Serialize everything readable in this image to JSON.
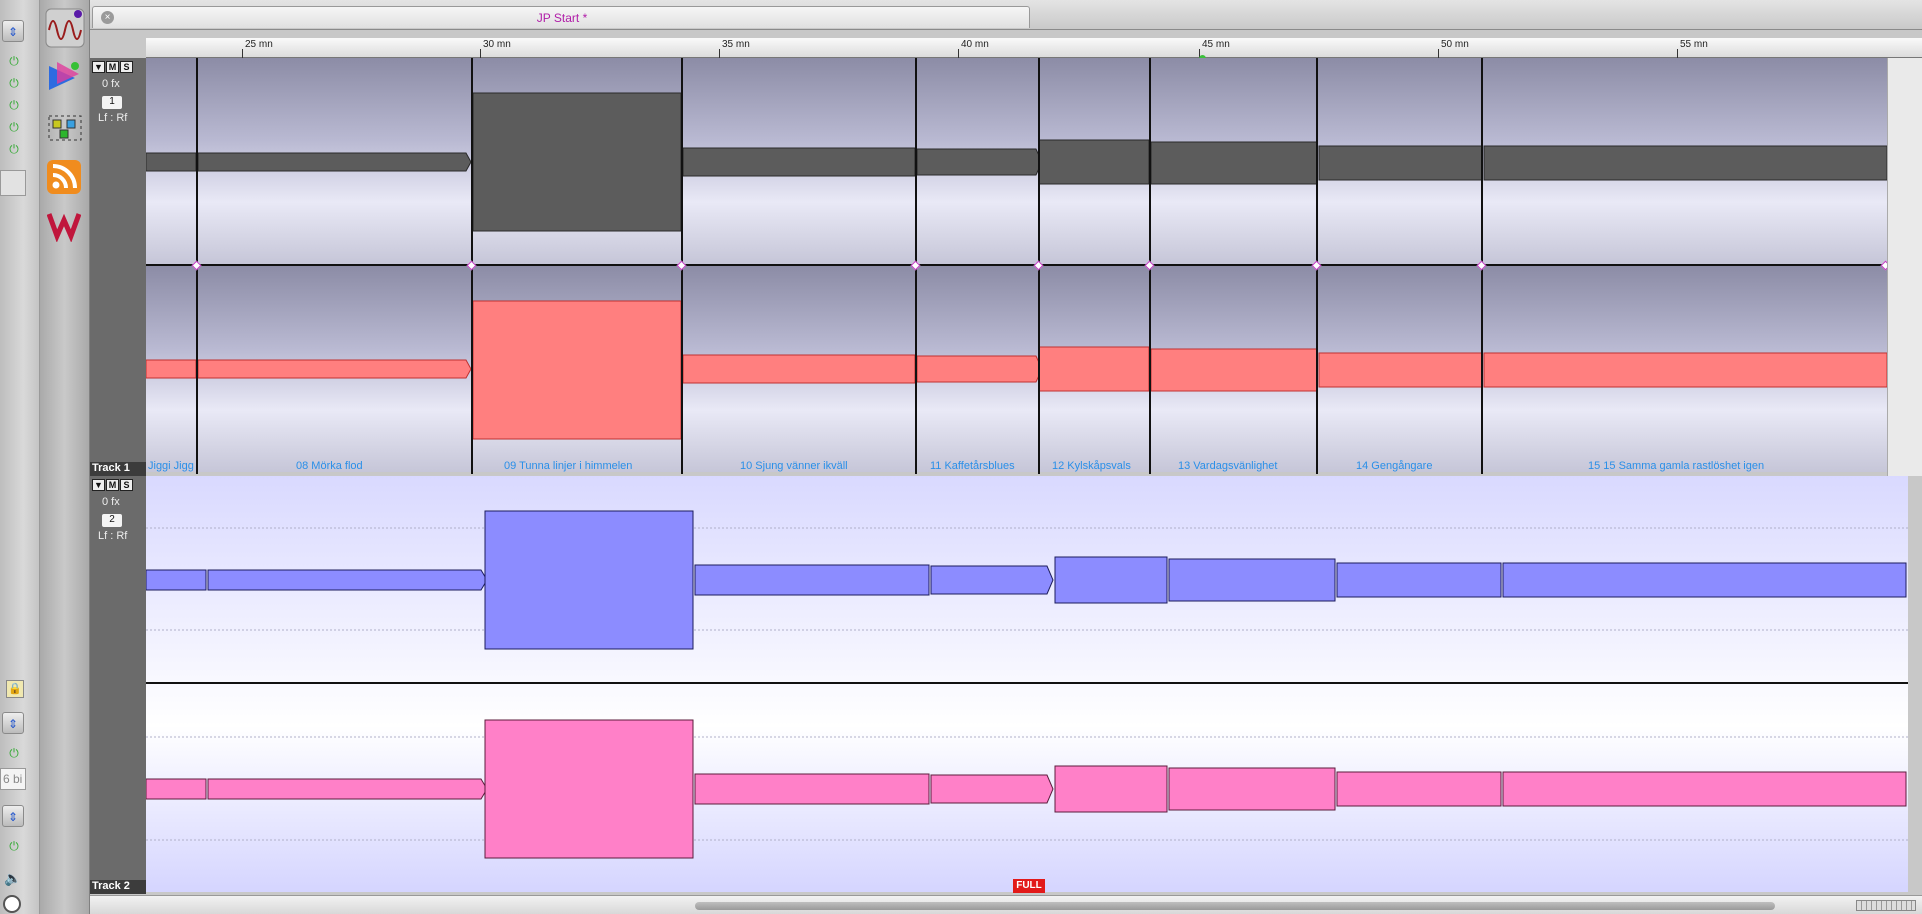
{
  "window": {
    "title": "JP Start *"
  },
  "ruler": {
    "labels": [
      "25 mn",
      "30 mn",
      "35 mn",
      "40 mn",
      "45 mn",
      "50 mn",
      "55 mn"
    ]
  },
  "tracks": [
    {
      "name": "Track 1",
      "number": "1",
      "fx": "0 fx",
      "routing": "Lf : Rf",
      "mute": "M",
      "solo": "S"
    },
    {
      "name": "Track 2",
      "number": "2",
      "fx": "0 fx",
      "routing": "Lf : Rf",
      "mute": "M",
      "solo": "S"
    }
  ],
  "clips": [
    "Jiggi Jigg",
    "08 Mörka flod",
    "09 Tunna linjer i himmelen",
    "10 Sjung vänner ikväll",
    "11 Kaffetårsblues",
    "12 Kylskåpsvals",
    "13 Vardagsvänlighet",
    "14 Gengångare",
    "15 15 Samma gamla rastlöshet igen"
  ],
  "status": {
    "full_label": "FULL",
    "left_field": "6 bi"
  },
  "colors": {
    "track1_top": "#5c5c5c",
    "track1_bottom": "#ff7f7f",
    "track2_top": "#8c8cff",
    "track2_bottom": "#ff80c8",
    "tab_title": "#b01ca8",
    "clip_name": "#2a8fe8"
  },
  "icons": [
    "waveform-icon",
    "effects-icon",
    "plugin-icon",
    "rss-icon",
    "wavelab-icon",
    "lock-icon",
    "speaker-icon",
    "clock-icon"
  ]
}
